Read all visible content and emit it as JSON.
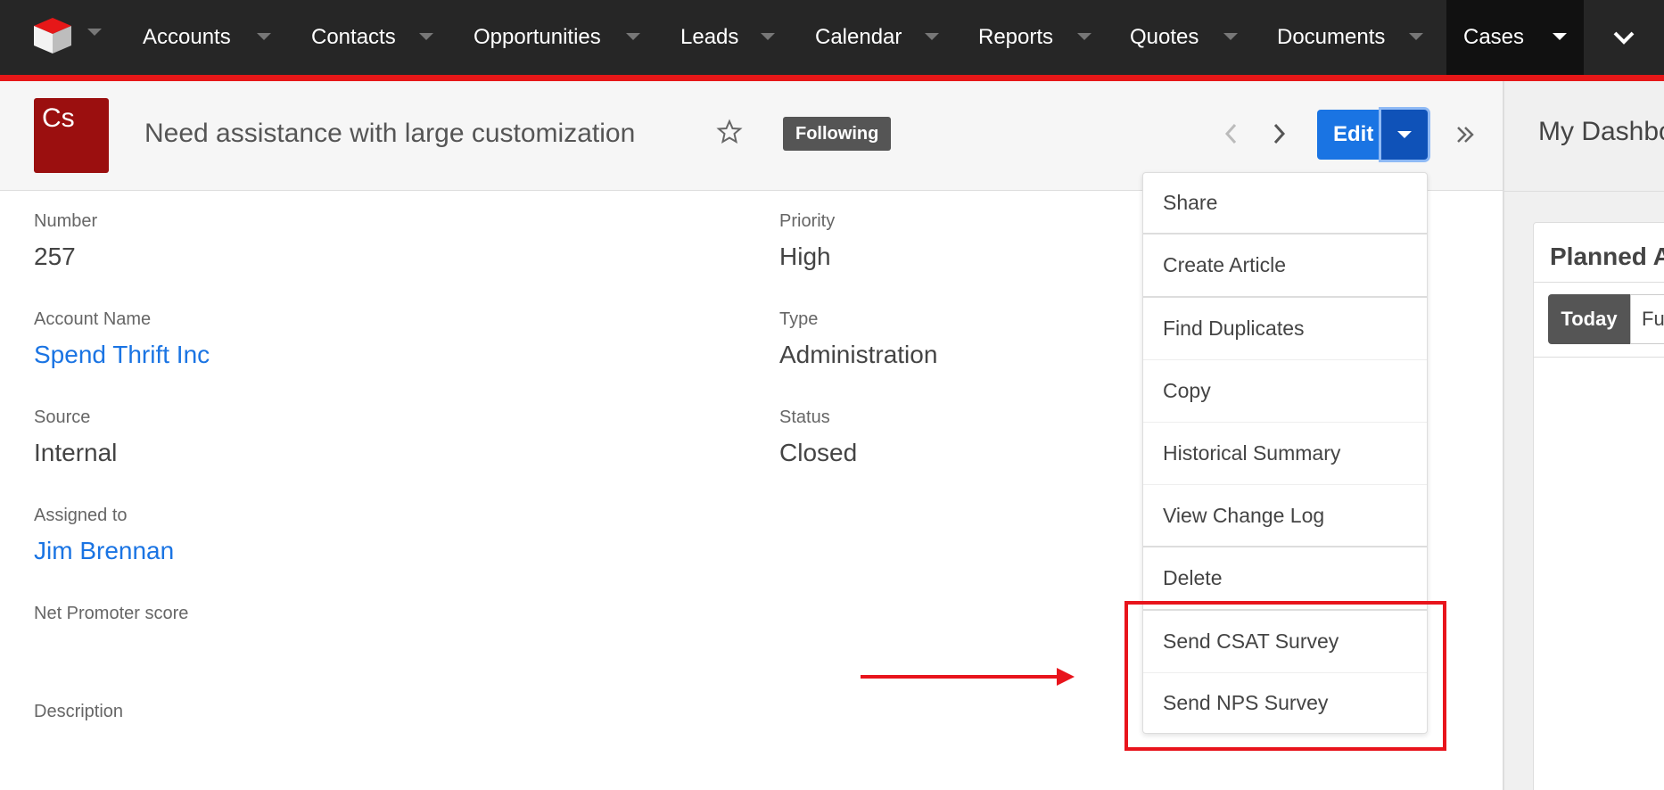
{
  "nav": {
    "items": [
      {
        "label": "Accounts"
      },
      {
        "label": "Contacts"
      },
      {
        "label": "Opportunities"
      },
      {
        "label": "Leads"
      },
      {
        "label": "Calendar"
      },
      {
        "label": "Reports"
      },
      {
        "label": "Quotes"
      },
      {
        "label": "Documents"
      },
      {
        "label": "Cases",
        "active": true
      }
    ],
    "accent_color": "#e61718"
  },
  "header": {
    "module_abbr": "Cs",
    "title": "Need assistance with large customization",
    "following_label": "Following",
    "edit_label": "Edit"
  },
  "fields": {
    "number": {
      "label": "Number",
      "value": "257"
    },
    "priority": {
      "label": "Priority",
      "value": "High"
    },
    "account_name": {
      "label": "Account Name",
      "value": "Spend Thrift Inc"
    },
    "type": {
      "label": "Type",
      "value": "Administration"
    },
    "source": {
      "label": "Source",
      "value": "Internal"
    },
    "status": {
      "label": "Status",
      "value": "Closed"
    },
    "assigned_to": {
      "label": "Assigned to",
      "value": "Jim Brennan"
    },
    "nps": {
      "label": "Net Promoter score",
      "value": ""
    },
    "description": {
      "label": "Description",
      "value": ""
    }
  },
  "actions_menu": {
    "items": [
      "Share",
      "Create Article",
      "Find Duplicates",
      "Copy",
      "Historical Summary",
      "View Change Log",
      "Delete",
      "Send CSAT Survey",
      "Send NPS Survey"
    ]
  },
  "right_pane": {
    "dashboard_title": "My Dashbo",
    "dashlet_title": "Planned A",
    "tabs": [
      "Today",
      "Fu"
    ]
  }
}
